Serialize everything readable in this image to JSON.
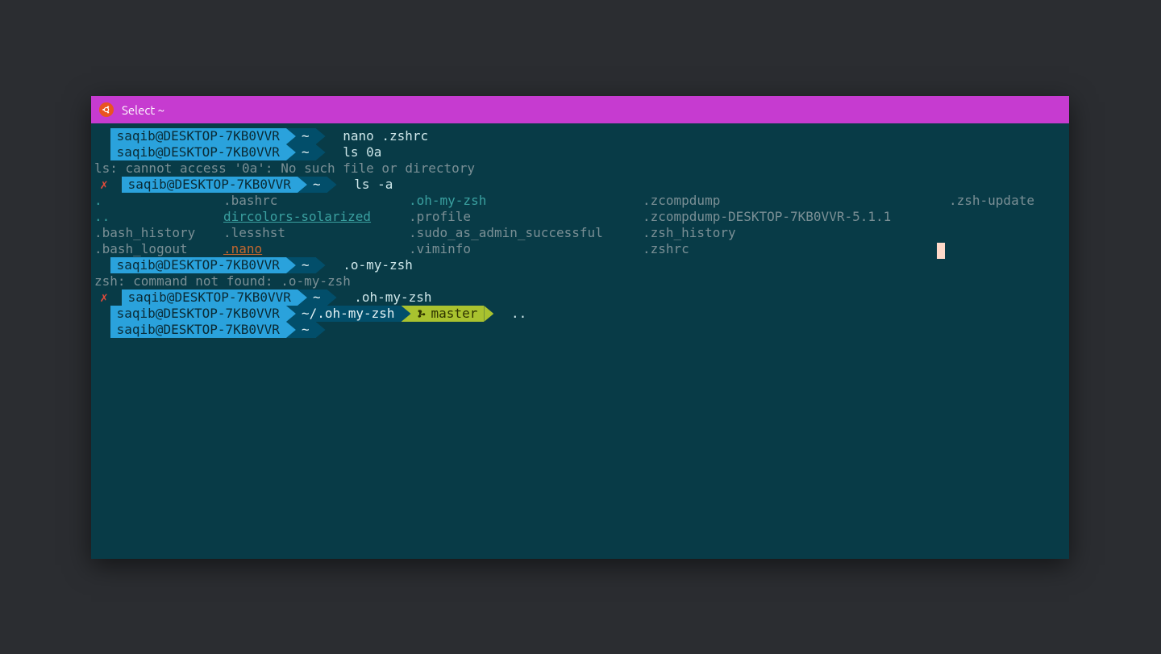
{
  "window": {
    "title": "Select ~"
  },
  "prompt": {
    "host": "saqib@DESKTOP-7KB0VVR",
    "home": "~"
  },
  "lines": {
    "l1_cmd": "nano .zshrc",
    "l2_cmd": "ls 0a",
    "l3_err": "ls: cannot access '0a': No such file or directory",
    "l4_cmd": "ls -a",
    "ls": {
      "c1": {
        "r1": ".",
        "r2": "..",
        "r3": ".bash_history",
        "r4": ".bash_logout"
      },
      "c2": {
        "r1": ".bashrc",
        "r2": "dircolors-solarized",
        "r3": ".lesshst",
        "r4": ".nano"
      },
      "c3": {
        "r1": ".oh-my-zsh",
        "r2": ".profile",
        "r3": ".sudo_as_admin_successful",
        "r4": ".viminfo"
      },
      "c4": {
        "r1": ".zcompdump",
        "r2": ".zcompdump-DESKTOP-7KB0VVR-5.1.1",
        "r3": ".zsh_history",
        "r4": ".zshrc"
      },
      "c5": {
        "r1": ".zsh-update"
      }
    },
    "l9_cmd": ".o-my-zsh",
    "l10_err": "zsh: command not found: .o-my-zsh",
    "l11_cmd": ".oh-my-zsh",
    "l12_path": "~/.oh-my-zsh",
    "l12_branch": "master",
    "l12_cmd": ".."
  }
}
